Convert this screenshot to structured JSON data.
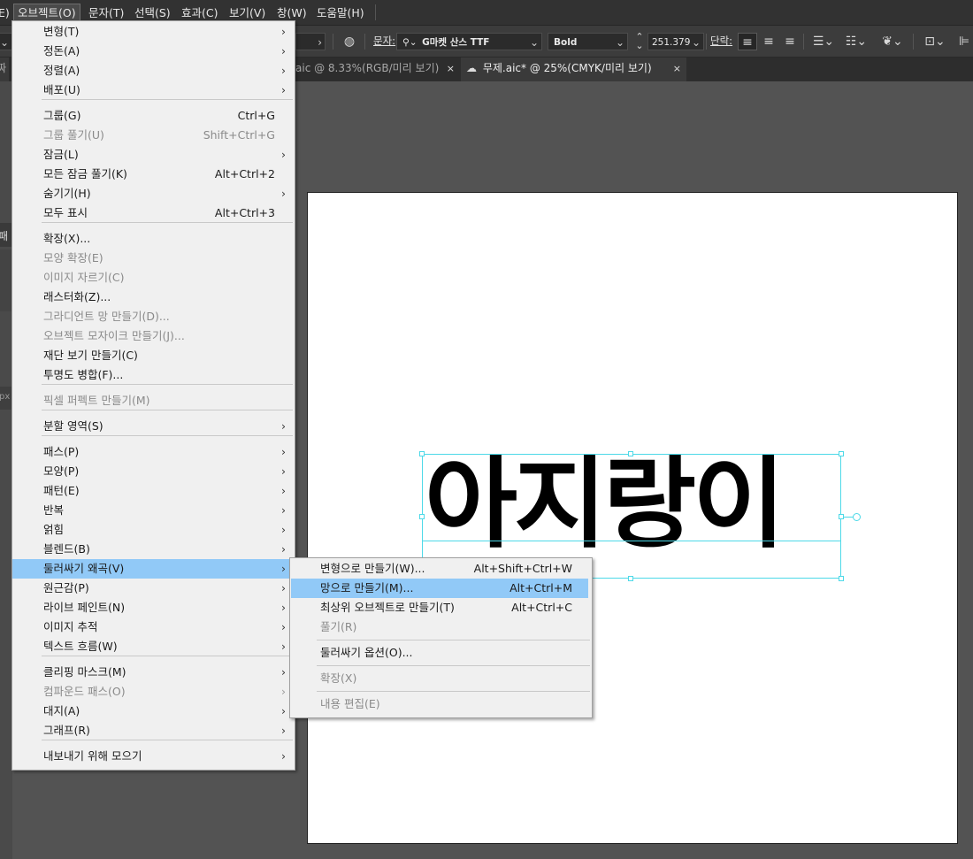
{
  "menubar": {
    "items": [
      {
        "label": "E)"
      },
      {
        "label": "오브젝트(O)"
      },
      {
        "label": "문자(T)"
      },
      {
        "label": "선택(S)"
      },
      {
        "label": "효과(C)"
      },
      {
        "label": "보기(V)"
      },
      {
        "label": "창(W)"
      },
      {
        "label": "도움말(H)"
      }
    ]
  },
  "control_bar": {
    "font_label": "문자:",
    "font_family": "G마켓 산스 TTF",
    "font_style": "Bold",
    "font_size": "251.379",
    "paragraph_label": "단락:"
  },
  "tabs": [
    {
      "label": "짜"
    },
    {
      "label": "aic @ 8.33%(RGB/미리 보기)",
      "close": "×"
    },
    {
      "label": "무제.aic* @ 25%(CMYK/미리 보기)",
      "close": "×"
    }
  ],
  "left_panel": {
    "fragment_1": "패",
    "fragment_2": "px"
  },
  "artboard": {
    "text": "아지랑이"
  },
  "main_menu": {
    "items": [
      {
        "label": "변형(T)",
        "submenu": true
      },
      {
        "label": "정돈(A)",
        "submenu": true
      },
      {
        "label": "정렬(A)",
        "submenu": true
      },
      {
        "label": "배포(U)",
        "submenu": true
      },
      {
        "label": "그룹(G)",
        "shortcut": "Ctrl+G"
      },
      {
        "label": "그룹 풀기(U)",
        "shortcut": "Shift+Ctrl+G",
        "disabled": true
      },
      {
        "label": "잠금(L)",
        "submenu": true
      },
      {
        "label": "모든 잠금 풀기(K)",
        "shortcut": "Alt+Ctrl+2"
      },
      {
        "label": "숨기기(H)",
        "submenu": true
      },
      {
        "label": "모두 표시",
        "shortcut": "Alt+Ctrl+3"
      },
      {
        "label": "확장(X)..."
      },
      {
        "label": "모양 확장(E)",
        "disabled": true
      },
      {
        "label": "이미지 자르기(C)",
        "disabled": true
      },
      {
        "label": "래스터화(Z)..."
      },
      {
        "label": "그라디언트 망 만들기(D)...",
        "disabled": true
      },
      {
        "label": "오브젝트 모자이크 만들기(J)...",
        "disabled": true
      },
      {
        "label": "재단 보기 만들기(C)"
      },
      {
        "label": "투명도 병합(F)..."
      },
      {
        "label": "픽셀 퍼펙트 만들기(M)",
        "disabled": true
      },
      {
        "label": "분할 영역(S)",
        "submenu": true
      },
      {
        "label": "패스(P)",
        "submenu": true
      },
      {
        "label": "모양(P)",
        "submenu": true
      },
      {
        "label": "패턴(E)",
        "submenu": true
      },
      {
        "label": "반복",
        "submenu": true
      },
      {
        "label": "얽힘",
        "submenu": true
      },
      {
        "label": "블렌드(B)",
        "submenu": true
      },
      {
        "label": "둘러싸기 왜곡(V)",
        "submenu": true,
        "highlighted": true
      },
      {
        "label": "원근감(P)",
        "submenu": true
      },
      {
        "label": "라이브 페인트(N)",
        "submenu": true
      },
      {
        "label": "이미지 추적",
        "submenu": true
      },
      {
        "label": "텍스트 흐름(W)",
        "submenu": true
      },
      {
        "label": "클리핑 마스크(M)",
        "submenu": true
      },
      {
        "label": "컴파운드 패스(O)",
        "submenu": true,
        "disabled": true
      },
      {
        "label": "대지(A)",
        "submenu": true
      },
      {
        "label": "그래프(R)",
        "submenu": true
      },
      {
        "label": "내보내기 위해 모으기",
        "submenu": true
      }
    ]
  },
  "envelope_submenu": {
    "items": [
      {
        "label": "변형으로 만들기(W)...",
        "shortcut": "Alt+Shift+Ctrl+W"
      },
      {
        "label": "망으로 만들기(M)...",
        "shortcut": "Alt+Ctrl+M",
        "highlighted": true
      },
      {
        "label": "최상위 오브젝트로 만들기(T)",
        "shortcut": "Alt+Ctrl+C"
      },
      {
        "label": "풀기(R)",
        "disabled": true
      },
      {
        "label": "둘러싸기 옵션(O)..."
      },
      {
        "label": "확장(X)",
        "disabled": true
      },
      {
        "label": "내용 편집(E)",
        "disabled": true
      }
    ]
  },
  "arrow_glyph": "›",
  "colors": {
    "highlight": "#91c9f7",
    "selection": "#4dd9e8",
    "ui_dark": "#323232",
    "pasteboard": "#535353"
  }
}
